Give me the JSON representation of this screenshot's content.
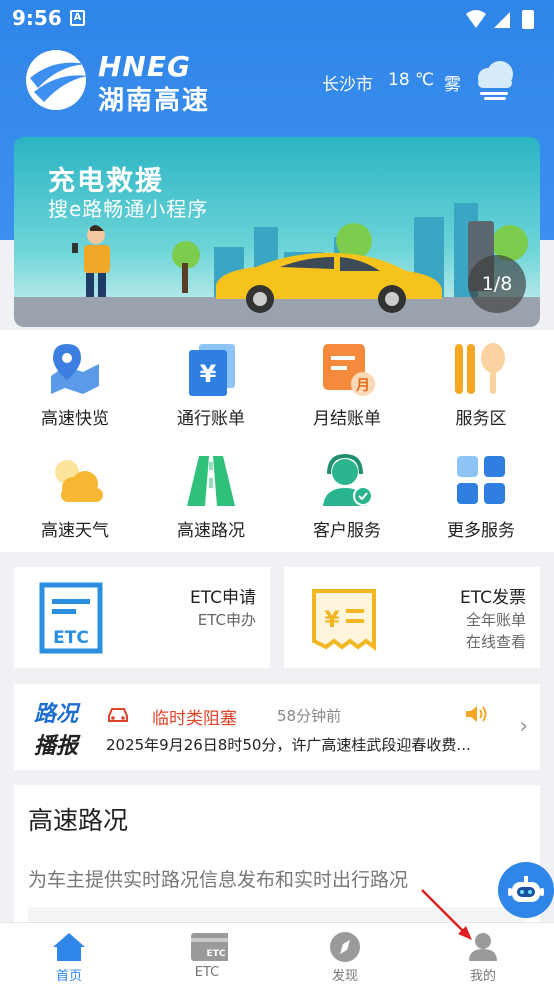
{
  "status": {
    "time": "9:56",
    "a_badge": "A"
  },
  "header": {
    "logo_en": "HNEG",
    "logo_cn": "湖南高速",
    "city": "长沙市",
    "temperature": "18 ℃",
    "weather": "雾",
    "weather_icon": "fog-cloud-icon"
  },
  "banner": {
    "title": "充电救援",
    "subtitle": "搜e路畅通小程序",
    "counter": "1/8"
  },
  "services": [
    {
      "label": "高速快览",
      "icon": "map-pin-icon"
    },
    {
      "label": "通行账单",
      "icon": "yen-bill-icon"
    },
    {
      "label": "月结账单",
      "icon": "monthly-bill-icon"
    },
    {
      "label": "服务区",
      "icon": "fork-spoon-icon"
    },
    {
      "label": "高速天气",
      "icon": "sun-cloud-icon"
    },
    {
      "label": "高速路况",
      "icon": "road-icon"
    },
    {
      "label": "客户服务",
      "icon": "customer-service-icon"
    },
    {
      "label": "更多服务",
      "icon": "more-grid-icon"
    }
  ],
  "etc_apply": {
    "title": "ETC申请",
    "subtitle": "ETC申办",
    "icon_text": "ETC"
  },
  "etc_invoice": {
    "title": "ETC发票",
    "line1": "全年账单",
    "line2": "在线查看"
  },
  "broadcast": {
    "brand_line1": "路况",
    "brand_line2": "播报",
    "type": "临时类阻塞",
    "time_ago": "58分钟前",
    "message": "2025年9月26日8时50分，许广高速桂武段迎春收费..."
  },
  "traffic": {
    "heading": "高速路况",
    "description": "为车主提供实时路况信息发布和实时出行路况"
  },
  "tabs": [
    {
      "label": "首页",
      "icon": "home-icon",
      "active": true
    },
    {
      "label": "ETC",
      "icon": "etc-card-icon",
      "active": false
    },
    {
      "label": "发现",
      "icon": "compass-icon",
      "active": false
    },
    {
      "label": "我的",
      "icon": "profile-icon",
      "active": false
    }
  ],
  "colors": {
    "primary": "#2f86e8",
    "alert": "#e0442a",
    "etc_blue": "#2a8fe0",
    "invoice_yellow": "#f2b623"
  }
}
